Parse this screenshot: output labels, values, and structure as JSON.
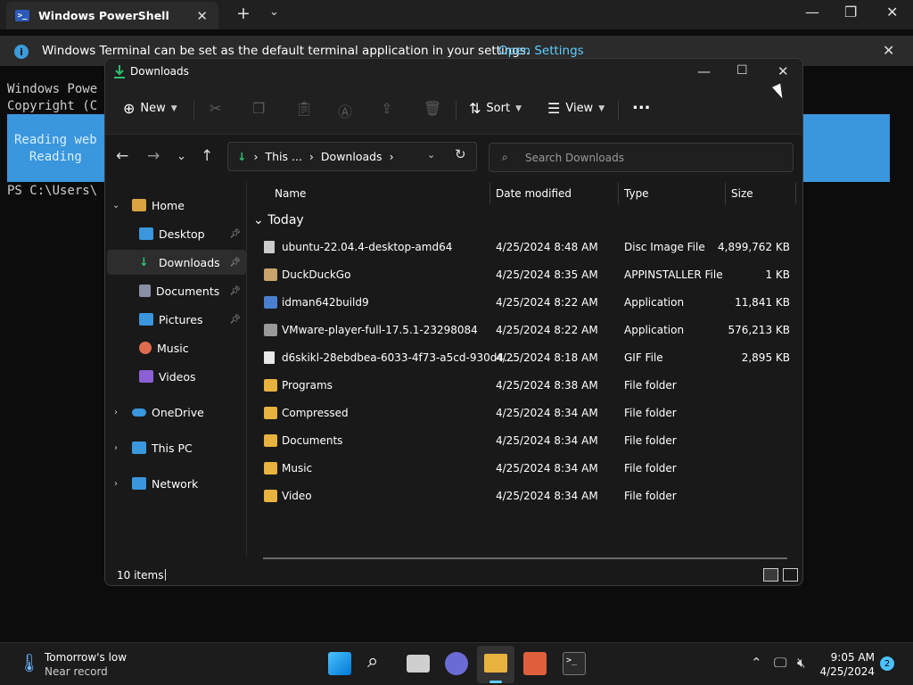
{
  "terminal": {
    "tab_title": "Windows PowerShell",
    "tab_icon": "powershell-icon",
    "info_text": "Windows Terminal can be set as the default terminal application in your settings.",
    "info_link": "Open Settings",
    "lines": [
      "Windows Powe",
      "Copyright (C",
      "PS C:\\Users\\"
    ],
    "progress_lines": [
      "Reading web",
      "  Reading"
    ]
  },
  "explorer": {
    "title": "Downloads",
    "toolbar": {
      "new_label": "New",
      "sort_label": "Sort",
      "view_label": "View",
      "more_label": "..."
    },
    "address": {
      "segments": [
        "This ...",
        "Downloads"
      ]
    },
    "search_placeholder": "Search Downloads",
    "sidebar": [
      {
        "label": "Home",
        "icon": "home-icon",
        "color": "#d9a441"
      },
      {
        "label": "Desktop",
        "icon": "desktop-icon",
        "color": "#3a96dd",
        "pinned": true
      },
      {
        "label": "Downloads",
        "icon": "download-icon",
        "color": "#2fbf71",
        "pinned": true,
        "selected": true
      },
      {
        "label": "Documents",
        "icon": "documents-icon",
        "color": "#8a8fa8",
        "pinned": true
      },
      {
        "label": "Pictures",
        "icon": "pictures-icon",
        "color": "#3a96dd",
        "pinned": true
      },
      {
        "label": "Music",
        "icon": "music-icon",
        "color": "#e06c4f"
      },
      {
        "label": "Videos",
        "icon": "videos-icon",
        "color": "#8b5fd6"
      },
      {
        "label": "OneDrive",
        "icon": "onedrive-icon",
        "color": "#3a96dd"
      },
      {
        "label": "This PC",
        "icon": "pc-icon",
        "color": "#3a96dd"
      },
      {
        "label": "Network",
        "icon": "network-icon",
        "color": "#3a96dd"
      }
    ],
    "columns": {
      "name": "Name",
      "date": "Date modified",
      "type": "Type",
      "size": "Size"
    },
    "group": "Today",
    "files": [
      {
        "name": "ubuntu-22.04.4-desktop-amd64",
        "date": "4/25/2024 8:48 AM",
        "type": "Disc Image File",
        "size": "4,899,762 KB",
        "icon": "disc-image-icon"
      },
      {
        "name": "DuckDuckGo",
        "date": "4/25/2024 8:35 AM",
        "type": "APPINSTALLER File",
        "size": "1 KB",
        "icon": "package-icon"
      },
      {
        "name": "idman642build9",
        "date": "4/25/2024 8:22 AM",
        "type": "Application",
        "size": "11,841 KB",
        "icon": "app-icon"
      },
      {
        "name": "VMware-player-full-17.5.1-23298084",
        "date": "4/25/2024 8:22 AM",
        "type": "Application",
        "size": "576,213 KB",
        "icon": "installer-icon"
      },
      {
        "name": "d6skikl-28ebdbea-6033-4f73-a5cd-930d4...",
        "date": "4/25/2024 8:18 AM",
        "type": "GIF File",
        "size": "2,895 KB",
        "icon": "gif-file-icon"
      },
      {
        "name": "Programs",
        "date": "4/25/2024 8:38 AM",
        "type": "File folder",
        "size": "",
        "icon": "folder-icon"
      },
      {
        "name": "Compressed",
        "date": "4/25/2024 8:34 AM",
        "type": "File folder",
        "size": "",
        "icon": "folder-icon"
      },
      {
        "name": "Documents",
        "date": "4/25/2024 8:34 AM",
        "type": "File folder",
        "size": "",
        "icon": "folder-icon"
      },
      {
        "name": "Music",
        "date": "4/25/2024 8:34 AM",
        "type": "File folder",
        "size": "",
        "icon": "folder-icon"
      },
      {
        "name": "Video",
        "date": "4/25/2024 8:34 AM",
        "type": "File folder",
        "size": "",
        "icon": "folder-icon"
      }
    ],
    "status": "10 items"
  },
  "taskbar": {
    "weather_line1": "Tomorrow's low",
    "weather_line2": "Near record",
    "time": "9:05 AM",
    "date": "4/25/2024",
    "notification_count": "2"
  },
  "colors": {
    "accent": "#60cdff",
    "folder": "#e8b23e",
    "progress": "#3a96dd"
  }
}
